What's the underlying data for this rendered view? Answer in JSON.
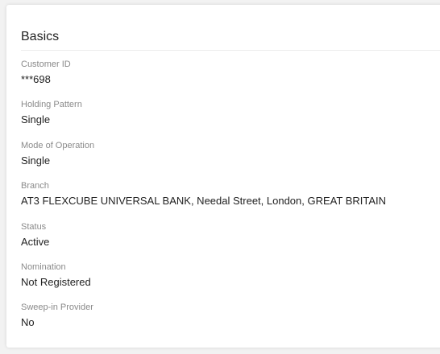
{
  "section": {
    "title": "Basics"
  },
  "fields": {
    "customer_id": {
      "label": "Customer ID",
      "value": "***698"
    },
    "holding_pattern": {
      "label": "Holding Pattern",
      "value": "Single"
    },
    "mode_of_operation": {
      "label": "Mode of Operation",
      "value": "Single"
    },
    "branch": {
      "label": "Branch",
      "value": "AT3 FLEXCUBE UNIVERSAL BANK, Needal Street, London, GREAT BRITAIN"
    },
    "status": {
      "label": "Status",
      "value": "Active"
    },
    "nomination": {
      "label": "Nomination",
      "value": "Not Registered"
    },
    "sweep_in_provider": {
      "label": "Sweep-in Provider",
      "value": "No"
    }
  }
}
